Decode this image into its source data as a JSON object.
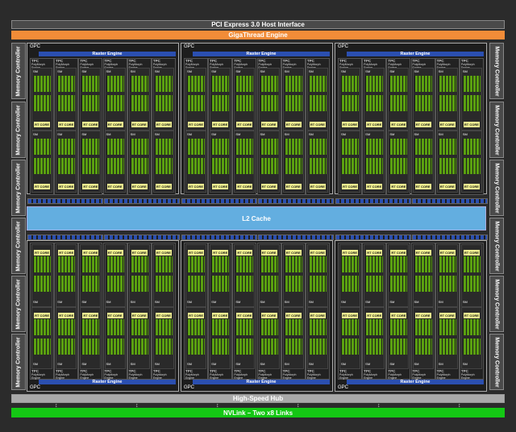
{
  "top": {
    "pcie": "PCI Express 3.0 Host Interface",
    "gigathread": "GigaThread Engine"
  },
  "bottom": {
    "hub": "High-Speed Hub",
    "nvlink": "NVLink – Two x8 Links"
  },
  "memory_controller_label": "Memory Controller",
  "l2_cache": "L2 Cache",
  "gpc_label": "GPC",
  "raster_engine": "Raster Engine",
  "tpc_label": "TPC",
  "polymorph_engine": "PolyMorph Engine",
  "sm_label": "SM",
  "rt_core": "RT CORE",
  "colors": {
    "background": "#2b2b2b",
    "gigathread": "#f28c38",
    "nvlink": "#14c814",
    "hub": "#a9a9a9",
    "l2_cache": "#63aee0",
    "raster_engine": "#2b4fb0",
    "cuda_cores": "#5aa010",
    "rt_core": "#f3f291"
  }
}
